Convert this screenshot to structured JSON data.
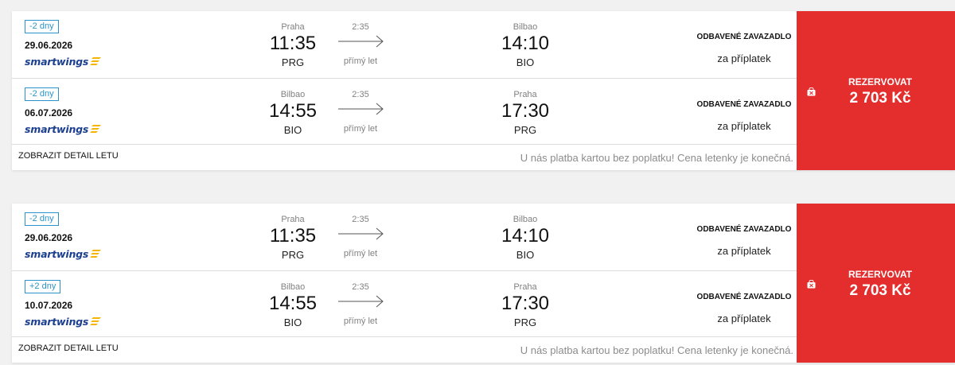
{
  "colors": {
    "accent_blue": "#2b93c9",
    "airline_blue": "#1c3f8f",
    "logo_yellow": "#f4b400",
    "price_red": "#e42d2d"
  },
  "results": [
    {
      "legs": [
        {
          "day_badge": "-2 dny",
          "date": "29.06.2026",
          "airline": "smartwings",
          "dep_city": "Praha",
          "dep_time": "11:35",
          "dep_code": "PRG",
          "duration": "2:35",
          "direct": "přímý let",
          "arr_city": "Bilbao",
          "arr_time": "14:10",
          "arr_code": "BIO",
          "baggage_title": "ODBAVENÉ ZAVAZADLO",
          "baggage_sub": "za příplatek"
        },
        {
          "day_badge": "-2 dny",
          "date": "06.07.2026",
          "airline": "smartwings",
          "dep_city": "Bilbao",
          "dep_time": "14:55",
          "dep_code": "BIO",
          "duration": "2:35",
          "direct": "přímý let",
          "arr_city": "Praha",
          "arr_time": "17:30",
          "arr_code": "PRG",
          "baggage_title": "ODBAVENÉ ZAVAZADLO",
          "baggage_sub": "za příplatek"
        }
      ],
      "detail_link": "ZOBRAZIT DETAIL LETU",
      "notice": "U nás platba kartou bez poplatku! Cena letenky je konečná.",
      "reserve_label": "REZERVOVAT",
      "price": "2 703 Kč"
    },
    {
      "legs": [
        {
          "day_badge": "-2 dny",
          "date": "29.06.2026",
          "airline": "smartwings",
          "dep_city": "Praha",
          "dep_time": "11:35",
          "dep_code": "PRG",
          "duration": "2:35",
          "direct": "přímý let",
          "arr_city": "Bilbao",
          "arr_time": "14:10",
          "arr_code": "BIO",
          "baggage_title": "ODBAVENÉ ZAVAZADLO",
          "baggage_sub": "za příplatek"
        },
        {
          "day_badge": "+2 dny",
          "date": "10.07.2026",
          "airline": "smartwings",
          "dep_city": "Bilbao",
          "dep_time": "14:55",
          "dep_code": "BIO",
          "duration": "2:35",
          "direct": "přímý let",
          "arr_city": "Praha",
          "arr_time": "17:30",
          "arr_code": "PRG",
          "baggage_title": "ODBAVENÉ ZAVAZADLO",
          "baggage_sub": "za příplatek"
        }
      ],
      "detail_link": "ZOBRAZIT DETAIL LETU",
      "notice": "U nás platba kartou bez poplatku! Cena letenky je konečná.",
      "reserve_label": "REZERVOVAT",
      "price": "2 703 Kč"
    }
  ]
}
